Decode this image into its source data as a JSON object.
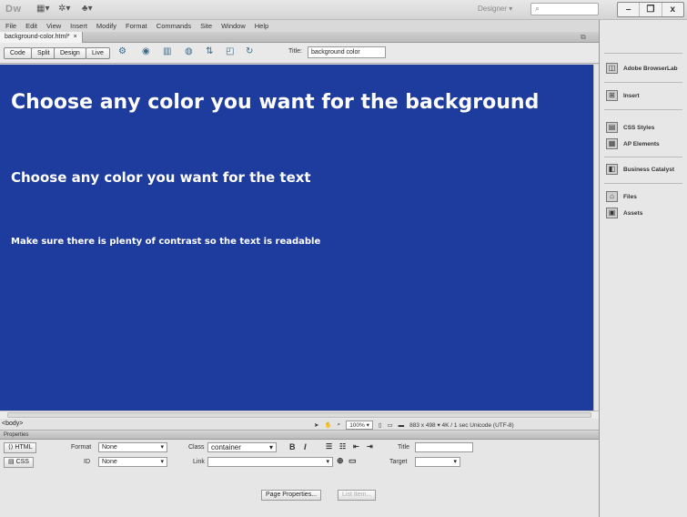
{
  "app": {
    "logo": "Dw",
    "workspace": "Designer",
    "window_controls": [
      "–",
      "❐",
      "x"
    ]
  },
  "menu": [
    "File",
    "Edit",
    "View",
    "Insert",
    "Modify",
    "Format",
    "Commands",
    "Site",
    "Window",
    "Help"
  ],
  "document": {
    "tab_name": "background-color.html*",
    "tab_close": "×"
  },
  "toolbar": {
    "views": [
      "Code",
      "Split",
      "Design",
      "Live"
    ],
    "title_label": "Title:",
    "title_value": "background color"
  },
  "design": {
    "heading1": "Choose any color you want for the background",
    "heading2": "Choose any color you want for the text",
    "paragraph": "Make sure there is plenty of contrast so the text is readable",
    "bg_color": "#1e3b9e",
    "text_color": "#ffffff"
  },
  "status": {
    "tag_selector": "<body>",
    "zoom": "100%",
    "size_info": "883 x 498 ▾  4K / 1 sec  Unicode (UTF-8)"
  },
  "properties": {
    "header": "Properties",
    "html_btn": "HTML",
    "css_btn": "CSS",
    "format_label": "Format",
    "format_value": "None",
    "class_label": "Class",
    "class_value": "container",
    "id_label": "ID",
    "id_value": "None",
    "link_label": "Link",
    "title_label": "Title",
    "target_label": "Target",
    "page_properties": "Page Properties...",
    "list_item": "List Item..."
  },
  "panels": [
    {
      "label": "Adobe BrowserLab",
      "icon": "browserlab-icon"
    },
    {
      "label": "Insert",
      "icon": "insert-icon"
    },
    {
      "label": "CSS Styles",
      "icon": "css-styles-icon"
    },
    {
      "label": "AP Elements",
      "icon": "ap-elements-icon"
    },
    {
      "label": "Business Catalyst",
      "icon": "business-catalyst-icon"
    },
    {
      "label": "Files",
      "icon": "files-icon"
    },
    {
      "label": "Assets",
      "icon": "assets-icon"
    }
  ]
}
